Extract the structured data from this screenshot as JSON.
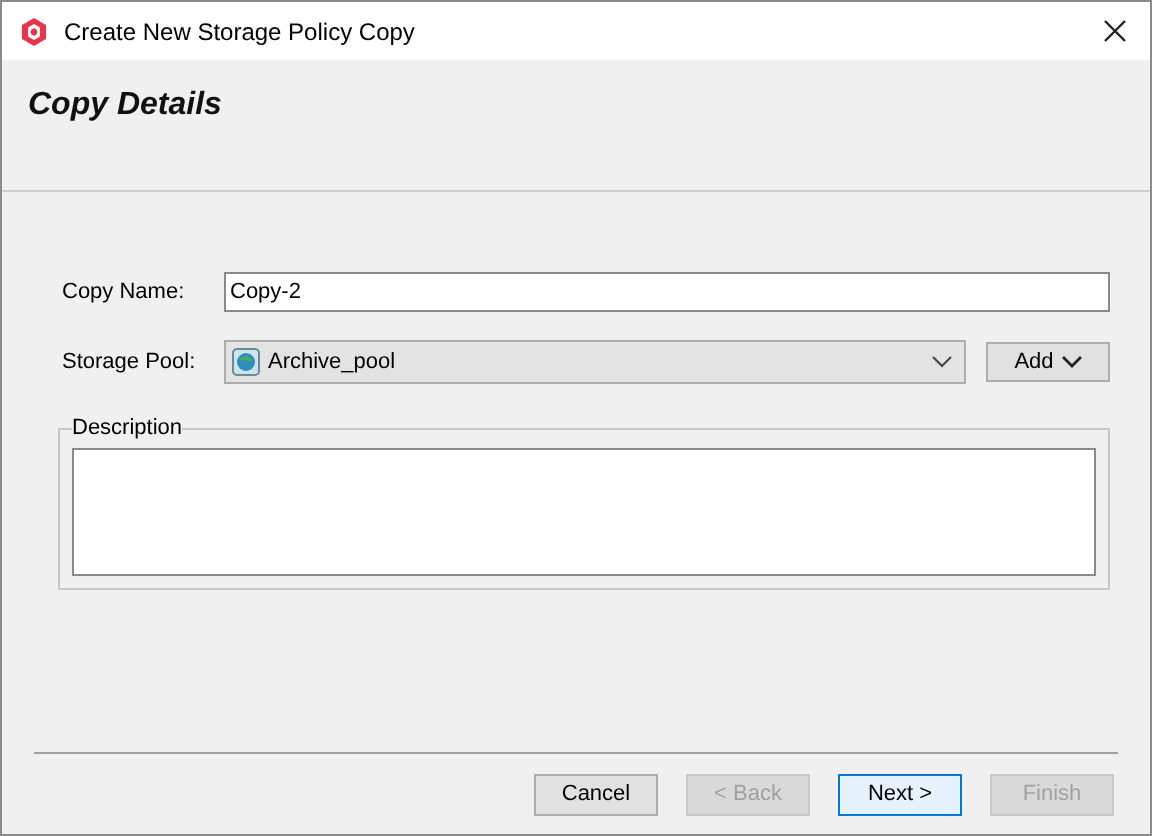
{
  "window": {
    "title": "Create New Storage Policy Copy"
  },
  "header": {
    "title": "Copy Details"
  },
  "copy_name": {
    "label": "Copy Name:",
    "value": "Copy-2"
  },
  "storage_pool": {
    "label": "Storage Pool:",
    "value": "Archive_pool",
    "add_button": "Add"
  },
  "description": {
    "label": "Description"
  },
  "buttons": [
    {
      "label": "Cancel",
      "disabled": false,
      "default": false
    },
    {
      "label": "< Back",
      "disabled": true,
      "default": false
    },
    {
      "label": "Next >",
      "disabled": false,
      "default": true
    },
    {
      "label": "Finish",
      "disabled": true,
      "default": false
    }
  ]
}
